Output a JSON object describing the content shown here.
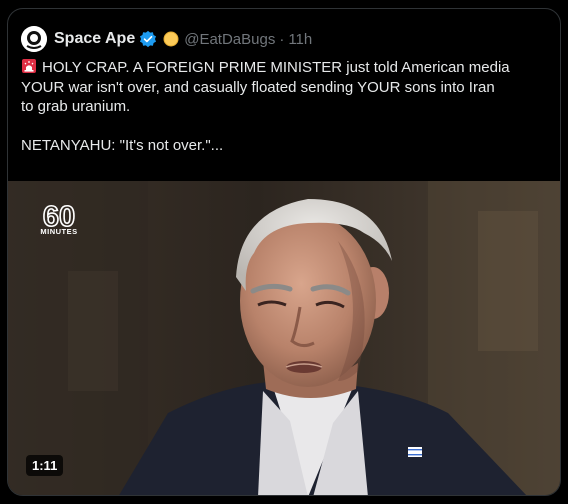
{
  "post": {
    "display_name": "Space Ape",
    "handle": "@EatDaBugs",
    "separator": "·",
    "time": "11h",
    "lines": [
      "HOLY CRAP. A FOREIGN PRIME MINISTER just told American media",
      "YOUR war isn't over, and casually floated sending YOUR sons into Iran",
      "to grab uranium.",
      "NETANYAHU: \"It's not over.\"..."
    ]
  },
  "media": {
    "logo_number": "60",
    "logo_word": "MINUTES",
    "duration": "1:11"
  },
  "colors": {
    "background": "#000000",
    "text": "#e7e9ea",
    "muted": "#71767b",
    "verified": "#1d9bf0",
    "border": "#2f3336"
  },
  "icons": {
    "verified": "verified-badge-icon",
    "siren": "rotating-light-emoji",
    "yellow_dot": "yellow-circle-emoji"
  }
}
